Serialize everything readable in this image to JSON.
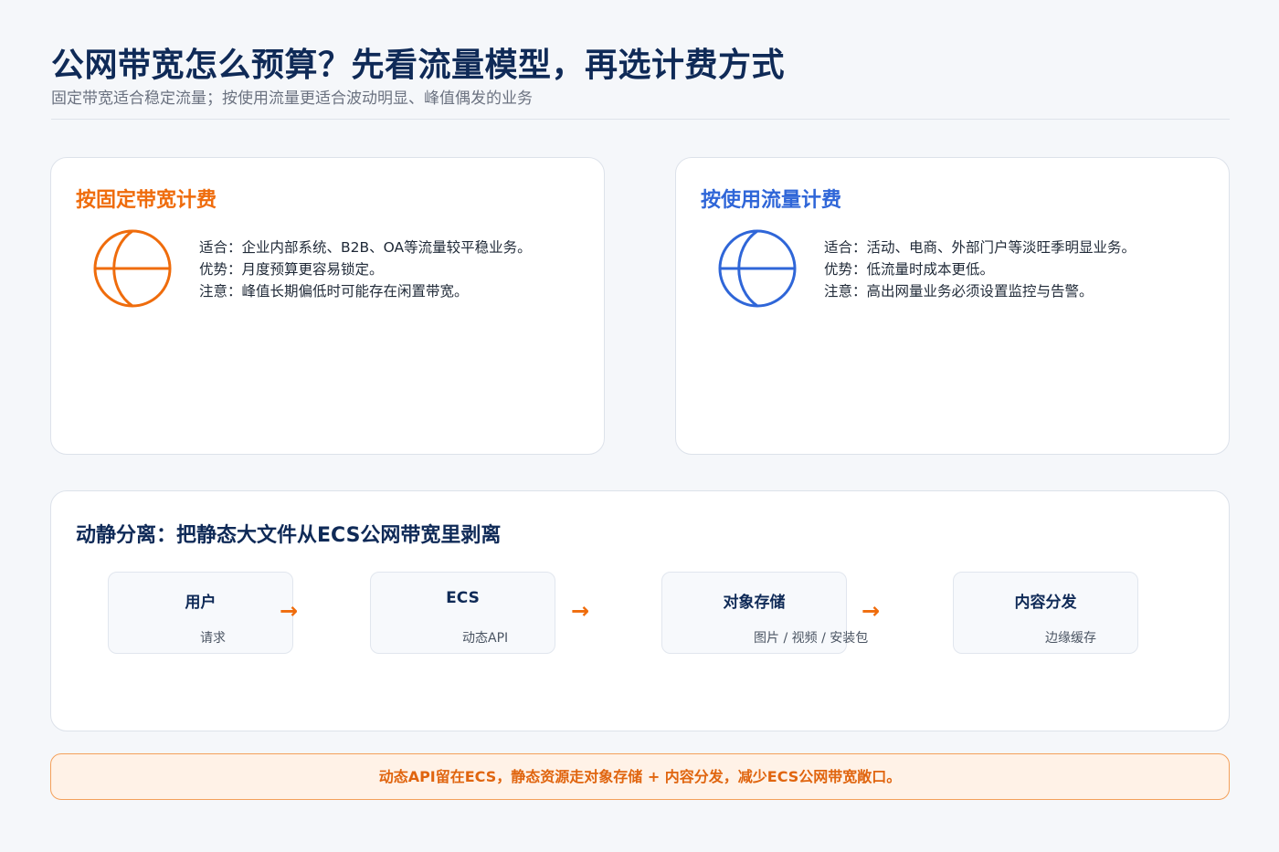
{
  "header": {
    "title": "公网带宽怎么预算？先看流量模型，再选计费方式",
    "subtitle": "固定带宽适合稳定流量；按使用流量更适合波动明显、峰值偶发的业务"
  },
  "fixed_card": {
    "title": "按固定带宽计费",
    "icon": "globe-icon",
    "color": "#ef6c0c",
    "lines": [
      "适合：企业内部系统、B2B、OA等流量较平稳业务。",
      "优势：月度预算更容易锁定。",
      "注意：峰值长期偏低时可能存在闲置带宽。"
    ]
  },
  "usage_card": {
    "title": "按使用流量计费",
    "icon": "globe-icon",
    "color": "#2f66d8",
    "lines": [
      "适合：活动、电商、外部门户等淡旺季明显业务。",
      "优势：低流量时成本更低。",
      "注意：高出网量业务必须设置监控与告警。"
    ]
  },
  "flow": {
    "title": "动静分离：把静态大文件从ECS公网带宽里剥离",
    "nodes": [
      {
        "name": "用户",
        "sub": "请求"
      },
      {
        "name": "ECS",
        "sub": "动态API"
      },
      {
        "name": "对象存储",
        "sub": "图片 / 视频 / 安装包"
      },
      {
        "name": "内容分发",
        "sub": "边缘缓存"
      }
    ],
    "arrow": "→"
  },
  "banner": {
    "text": "动态API留在ECS，静态资源走对象存储 + 内容分发，减少ECS公网带宽敞口。"
  }
}
